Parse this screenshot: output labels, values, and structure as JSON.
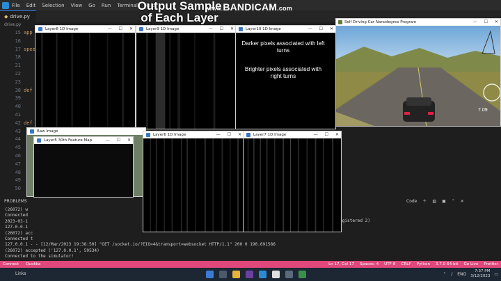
{
  "vscode": {
    "menu": [
      "File",
      "Edit",
      "Selection",
      "View",
      "Go",
      "Run",
      "Terminal",
      "Help"
    ],
    "tab_file": "drive.py",
    "breadcrumb": "drive.py",
    "line_numbers": [
      "15",
      "16",
      "17",
      "18",
      "21",
      "22",
      "23",
      "38",
      "39",
      "40",
      "41",
      "42",
      "43",
      "44",
      "45",
      "46",
      "47",
      "48",
      "49",
      "50"
    ],
    "code_tokens": {
      "app": "app",
      "spee": "spee",
      "def1": "def",
      "def2": "def"
    }
  },
  "caption": {
    "line1": "Output Sample",
    "line2": "of Each Layer"
  },
  "watermark": {
    "www": "www.",
    "brand": "BANDICAM",
    "com": ".com"
  },
  "windows": {
    "layer8": "Layer8 1D Image",
    "layer9": "Layer9 1D Image",
    "layer10": "Layer10 1D Image",
    "raw": "Raw Image",
    "layer5": "Layer5 30th Feature Map",
    "layer6": "Layer6 1D Image",
    "layer7": "Layer7 1D Image",
    "car": "Self Driving Car Nanodegree Program"
  },
  "annotation": {
    "dark": "Darker pixels associated with left turns",
    "bright": "Brighter pixels associated with right turns"
  },
  "car": {
    "speed": "7.09"
  },
  "panel": {
    "problems": "PROBLEMS",
    "code": "Code",
    "lines": [
      "(26072) w",
      "Connected",
      "2023-03-1",
      "127.0.0.1",
      "(26072) acc",
      "Connected t",
      "127.0.0.1 - - [12/Mar/2023 19:38:50] \"GET /socket.io/?EIO=4&transport=websocket HTTP/1.1\" 200 0 190.691586",
      "(26072) accepted ('127.0.0.1', 59534)",
      "Connected to the simulator!"
    ],
    "registered": "egistered 2)"
  },
  "statusbar": {
    "left": [
      "Connect",
      "Quokka"
    ],
    "right": [
      "Ln 17, Col 17",
      "Spaces: 4",
      "UTF-8",
      "CRLF",
      "Python",
      "3.7.0 64-bit",
      "Go Live",
      "Prettier"
    ]
  },
  "taskbar": {
    "links": "Links",
    "lang": "ENG",
    "time": "7:37 PM",
    "date": "3/12/2023"
  },
  "colors": {
    "status": "#e0477a",
    "taskbar": "#1c2733",
    "editor": "#1e1e1e"
  }
}
